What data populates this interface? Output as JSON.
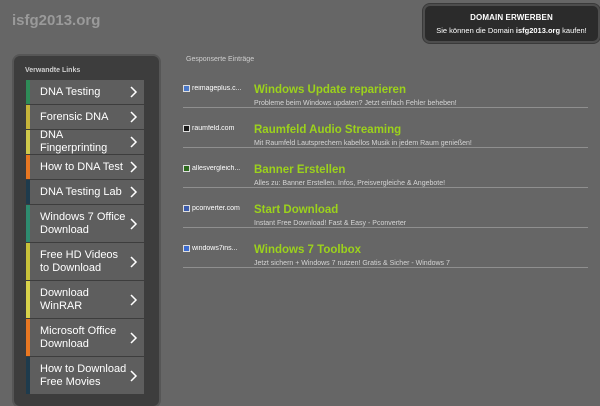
{
  "site": {
    "name": "isfg2013.org"
  },
  "domain_box": {
    "title": "DOMAIN ERWERBEN",
    "line_prefix": "Sie können die Domain",
    "domain": "isfg2013.org",
    "line_suffix": "kaufen!"
  },
  "sidebar": {
    "title": "Verwandte Links",
    "items": [
      {
        "label": "DNA Testing",
        "accent": "#2e8b57"
      },
      {
        "label": "Forensic DNA",
        "accent": "#c6b43a"
      },
      {
        "label": "DNA Fingerprinting",
        "accent": "#cfc94b"
      },
      {
        "label": "How to DNA Test",
        "accent": "#e87722"
      },
      {
        "label": "DNA Testing Lab",
        "accent": "#1e3b4d"
      },
      {
        "label": "Windows 7 Office Download",
        "accent": "#2e8b6f"
      },
      {
        "label": "Free HD Videos to Download",
        "accent": "#c8c23a"
      },
      {
        "label": "Download WinRAR",
        "accent": "#d8d24a"
      },
      {
        "label": "Microsoft Office Download",
        "accent": "#e87722"
      },
      {
        "label": "How to Download Free Movies",
        "accent": "#1e3b4d"
      }
    ]
  },
  "main": {
    "title": "Gesponserte Einträge",
    "ads": [
      {
        "source": "reimageplus.c...",
        "icon": "reimage-icon",
        "headline": "Windows Update reparieren",
        "description": "Probleme beim Windows updaten? Jetzt einfach Fehler beheben!"
      },
      {
        "source": "raumfeld.com",
        "icon": "raumfeld-icon",
        "headline": "Raumfeld Audio Streaming",
        "description": "Mit Raumfeld Lautsprechern kabellos Musik in jedem Raum genießen!"
      },
      {
        "source": "allesvergleich...",
        "icon": "allesvergleichen-icon",
        "headline": "Banner Erstellen",
        "description": "Alles zu: Banner Erstellen. Infos, Preisvergleiche & Angebote!"
      },
      {
        "source": "pconverter.com",
        "icon": "pconverter-icon",
        "headline": "Start Download",
        "description": "Instant Free Download! Fast & Easy - Pconverter"
      },
      {
        "source": "windows7ins...",
        "icon": "windows7-icon",
        "headline": "Windows 7 Toolbox",
        "description": "Jetzt sichern + Windows 7 nutzen! Gratis & Sicher - Windows 7"
      }
    ]
  }
}
